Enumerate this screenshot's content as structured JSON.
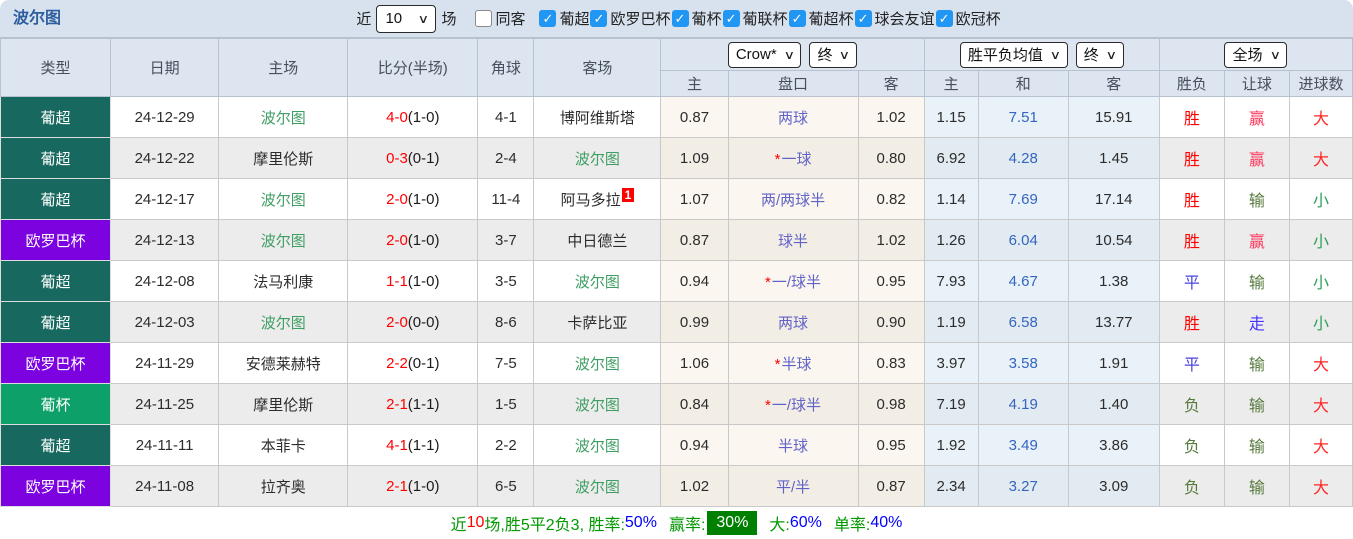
{
  "title": "波尔图",
  "topbar": {
    "near_label": "近",
    "matches_value": "10",
    "games_label": "场",
    "same_away": {
      "label": "同客",
      "checked": false
    },
    "leagues": [
      {
        "label": "葡超",
        "checked": true
      },
      {
        "label": "欧罗巴杯",
        "checked": true
      },
      {
        "label": "葡杯",
        "checked": true
      },
      {
        "label": "葡联杯",
        "checked": true
      },
      {
        "label": "葡超杯",
        "checked": true
      },
      {
        "label": "球会友谊",
        "checked": true
      },
      {
        "label": "欧冠杯",
        "checked": true
      }
    ]
  },
  "header": {
    "type": "类型",
    "date": "日期",
    "home": "主场",
    "score": "比分(半场)",
    "corner": "角球",
    "away": "客场",
    "odds_select": "Crow*",
    "odds_time_select": "终",
    "odds_sub": [
      "主",
      "盘口",
      "客"
    ],
    "mean_select": "胜平负均值",
    "mean_time_select": "终",
    "mean_sub": [
      "主",
      "和",
      "客"
    ],
    "period_select": "全场",
    "result_sub": [
      "胜负",
      "让球",
      "进球数"
    ]
  },
  "league_colors": {
    "葡超": "#17695f",
    "欧罗巴杯": "#7c02df",
    "葡杯": "#0da169"
  },
  "result_colors": {
    "胜": "#ff0000",
    "平": "#4a43e0",
    "负": "#567a3c",
    "赢": "#ff3a5e",
    "输": "#567a3c",
    "走": "#4433ff",
    "大": "#ff2626",
    "小": "#2e9e5b"
  },
  "rows": [
    {
      "type": "葡超",
      "date": "24-12-29",
      "home": "波尔图",
      "home_self": true,
      "score": "4-0",
      "half": "(1-0)",
      "corner": "4-1",
      "away": "博阿维斯塔",
      "away_self": false,
      "away_note": "",
      "odds_home": "0.87",
      "handicap": "两球",
      "handicap_star": false,
      "odds_away": "1.02",
      "mean_home": "1.15",
      "mean_draw": "7.51",
      "mean_away": "15.91",
      "result": "胜",
      "let_result": "赢",
      "goal_result": "大"
    },
    {
      "type": "葡超",
      "date": "24-12-22",
      "home": "摩里伦斯",
      "home_self": false,
      "score": "0-3",
      "half": "(0-1)",
      "corner": "2-4",
      "away": "波尔图",
      "away_self": true,
      "away_note": "",
      "odds_home": "1.09",
      "handicap": "一球",
      "handicap_star": true,
      "odds_away": "0.80",
      "mean_home": "6.92",
      "mean_draw": "4.28",
      "mean_away": "1.45",
      "result": "胜",
      "let_result": "赢",
      "goal_result": "大"
    },
    {
      "type": "葡超",
      "date": "24-12-17",
      "home": "波尔图",
      "home_self": true,
      "score": "2-0",
      "half": "(1-0)",
      "corner": "11-4",
      "away": "阿马多拉",
      "away_self": false,
      "away_note": "1",
      "odds_home": "1.07",
      "handicap": "两/两球半",
      "handicap_star": false,
      "odds_away": "0.82",
      "mean_home": "1.14",
      "mean_draw": "7.69",
      "mean_away": "17.14",
      "result": "胜",
      "let_result": "输",
      "goal_result": "小"
    },
    {
      "type": "欧罗巴杯",
      "date": "24-12-13",
      "home": "波尔图",
      "home_self": true,
      "score": "2-0",
      "half": "(1-0)",
      "corner": "3-7",
      "away": "中日德兰",
      "away_self": false,
      "away_note": "",
      "odds_home": "0.87",
      "handicap": "球半",
      "handicap_star": false,
      "odds_away": "1.02",
      "mean_home": "1.26",
      "mean_draw": "6.04",
      "mean_away": "10.54",
      "result": "胜",
      "let_result": "赢",
      "goal_result": "小"
    },
    {
      "type": "葡超",
      "date": "24-12-08",
      "home": "法马利康",
      "home_self": false,
      "score": "1-1",
      "half": "(1-0)",
      "corner": "3-5",
      "away": "波尔图",
      "away_self": true,
      "away_note": "",
      "odds_home": "0.94",
      "handicap": "一/球半",
      "handicap_star": true,
      "odds_away": "0.95",
      "mean_home": "7.93",
      "mean_draw": "4.67",
      "mean_away": "1.38",
      "result": "平",
      "let_result": "输",
      "goal_result": "小"
    },
    {
      "type": "葡超",
      "date": "24-12-03",
      "home": "波尔图",
      "home_self": true,
      "score": "2-0",
      "half": "(0-0)",
      "corner": "8-6",
      "away": "卡萨比亚",
      "away_self": false,
      "away_note": "",
      "odds_home": "0.99",
      "handicap": "两球",
      "handicap_star": false,
      "odds_away": "0.90",
      "mean_home": "1.19",
      "mean_draw": "6.58",
      "mean_away": "13.77",
      "result": "胜",
      "let_result": "走",
      "goal_result": "小"
    },
    {
      "type": "欧罗巴杯",
      "date": "24-11-29",
      "home": "安德莱赫特",
      "home_self": false,
      "score": "2-2",
      "half": "(0-1)",
      "corner": "7-5",
      "away": "波尔图",
      "away_self": true,
      "away_note": "",
      "odds_home": "1.06",
      "handicap": "半球",
      "handicap_star": true,
      "odds_away": "0.83",
      "mean_home": "3.97",
      "mean_draw": "3.58",
      "mean_away": "1.91",
      "result": "平",
      "let_result": "输",
      "goal_result": "大"
    },
    {
      "type": "葡杯",
      "date": "24-11-25",
      "home": "摩里伦斯",
      "home_self": false,
      "score": "2-1",
      "half": "(1-1)",
      "corner": "1-5",
      "away": "波尔图",
      "away_self": true,
      "away_note": "",
      "odds_home": "0.84",
      "handicap": "一/球半",
      "handicap_star": true,
      "odds_away": "0.98",
      "mean_home": "7.19",
      "mean_draw": "4.19",
      "mean_away": "1.40",
      "result": "负",
      "let_result": "输",
      "goal_result": "大"
    },
    {
      "type": "葡超",
      "date": "24-11-11",
      "home": "本菲卡",
      "home_self": false,
      "score": "4-1",
      "half": "(1-1)",
      "corner": "2-2",
      "away": "波尔图",
      "away_self": true,
      "away_note": "",
      "odds_home": "0.94",
      "handicap": "半球",
      "handicap_star": false,
      "odds_away": "0.95",
      "mean_home": "1.92",
      "mean_draw": "3.49",
      "mean_away": "3.86",
      "result": "负",
      "let_result": "输",
      "goal_result": "大"
    },
    {
      "type": "欧罗巴杯",
      "date": "24-11-08",
      "home": "拉齐奥",
      "home_self": false,
      "score": "2-1",
      "half": "(1-0)",
      "corner": "6-5",
      "away": "波尔图",
      "away_self": true,
      "away_note": "",
      "odds_home": "1.02",
      "handicap": "平/半",
      "handicap_star": false,
      "odds_away": "0.87",
      "mean_home": "2.34",
      "mean_draw": "3.27",
      "mean_away": "3.09",
      "result": "负",
      "let_result": "输",
      "goal_result": "大"
    }
  ],
  "summary": {
    "prefix": "近",
    "count": "10",
    "mid": "场,胜5平2负3, 胜率:",
    "win_rate": "50%",
    "let_label": "赢率:",
    "let_rate": "30%",
    "big_label": "大:",
    "big_rate": "60%",
    "single_label": "单率:",
    "single_rate": "40%"
  }
}
